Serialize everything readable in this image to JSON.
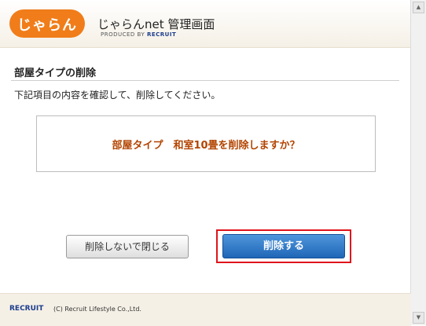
{
  "header": {
    "logo_text": "じゃらん",
    "title": "じゃらんnet 管理画面",
    "produced_by": "PRODUCED BY",
    "produced_brand": "RECRUIT"
  },
  "section": {
    "title": "部屋タイプの削除",
    "description": "下記項目の内容を確認して、削除してください。"
  },
  "confirm": {
    "message": "部屋タイプ　和室10畳を削除しますか？"
  },
  "buttons": {
    "close_label": "削除しないで閉じる",
    "delete_label": "削除する"
  },
  "footer": {
    "brand": "RECRUIT",
    "copyright": "(C) Recruit Lifestyle Co.,Ltd."
  },
  "colors": {
    "brand_orange": "#f07d1a",
    "confirm_text": "#b34400",
    "delete_button": "#1f66b7",
    "highlight": "#e0141b"
  }
}
